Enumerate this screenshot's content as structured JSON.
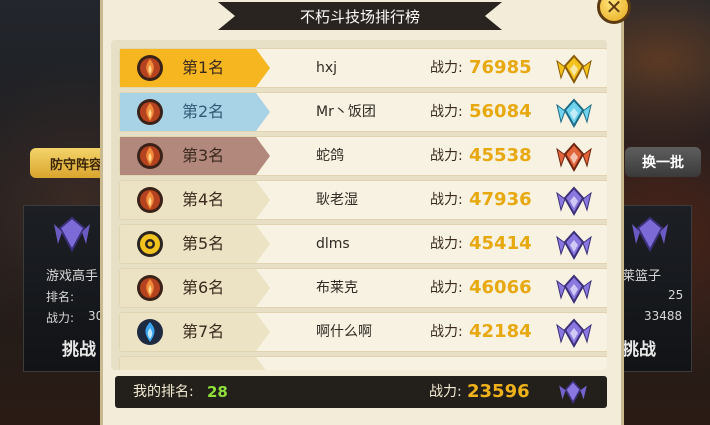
{
  "title": "不朽斗技场排行榜",
  "rows": [
    {
      "rank_label": "第1名",
      "name": "hxj",
      "power_label": "战力:",
      "power": "76985",
      "tier": "gold",
      "rank_icon": "fire-medal-icon",
      "badge_icon": "gold-wings-badge-icon"
    },
    {
      "rank_label": "第2名",
      "name": "Mr丶饭团",
      "power_label": "战力:",
      "power": "56084",
      "tier": "silver",
      "rank_icon": "fire-medal-icon",
      "badge_icon": "cyan-wings-badge-icon"
    },
    {
      "rank_label": "第3名",
      "name": "蛇鸽",
      "power_label": "战力:",
      "power": "45538",
      "tier": "bronze",
      "rank_icon": "fire-medal-icon",
      "badge_icon": "orange-wings-badge-icon"
    },
    {
      "rank_label": "第4名",
      "name": "耿老湿",
      "power_label": "战力:",
      "power": "47936",
      "tier": "plain",
      "rank_icon": "fire-medal-icon",
      "badge_icon": "purple-wings-badge-icon"
    },
    {
      "rank_label": "第5名",
      "name": "dlms",
      "power_label": "战力:",
      "power": "45414",
      "tier": "plain",
      "rank_icon": "gold-swirl-medal-icon",
      "badge_icon": "purple-wings-badge-icon"
    },
    {
      "rank_label": "第6名",
      "name": "布莱克",
      "power_label": "战力:",
      "power": "46066",
      "tier": "plain",
      "rank_icon": "fire-medal-icon",
      "badge_icon": "purple-wings-badge-icon"
    },
    {
      "rank_label": "第7名",
      "name": "啊什么啊",
      "power_label": "战力:",
      "power": "42184",
      "tier": "plain",
      "rank_icon": "blue-flame-medal-icon",
      "badge_icon": "purple-wings-badge-icon"
    }
  ],
  "my_rank": {
    "label": "我的排名:",
    "value": "28",
    "power_label": "战力:",
    "power": "23596",
    "badge_icon": "purple-wings-badge-icon"
  },
  "background": {
    "left_button": "防守阵容",
    "right_button": "换一批",
    "left_card": {
      "name": "游戏高手",
      "rank_label": "排名:",
      "power_label": "战力:",
      "power": "30",
      "action": "挑战"
    },
    "right_card": {
      "name": "莱篮子",
      "rank": "25",
      "power": "33488",
      "action": "挑战"
    }
  },
  "colors": {
    "gold_tab": "#f6b620",
    "silver_tab": "#a8d3e6",
    "bronze_tab": "#b2877c",
    "power": "#e8a80f",
    "my_rank": "#8fe03a"
  }
}
